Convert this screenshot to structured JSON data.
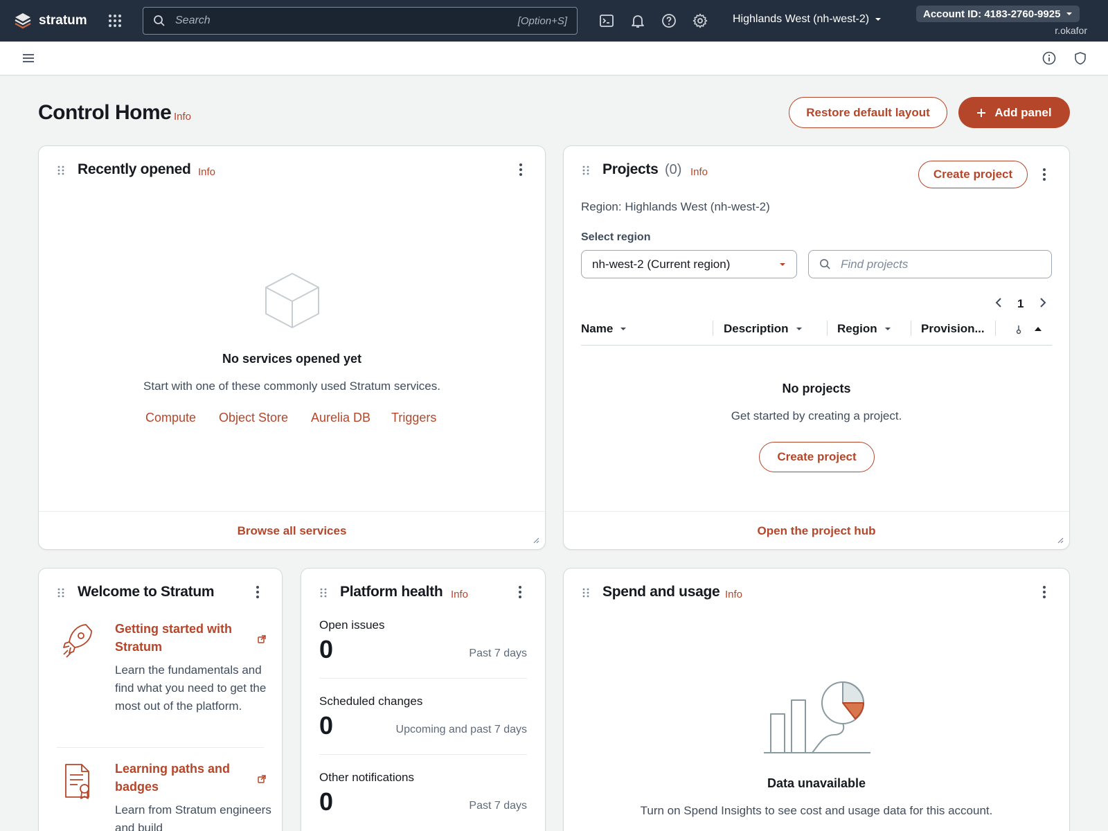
{
  "topnav": {
    "brand": "stratum",
    "search_placeholder": "Search",
    "search_shortcut": "[Option+S]",
    "region": "Highlands West (nh-west-2)",
    "account": "Account ID: 4183-2760-9925",
    "user": "r.okafor"
  },
  "page": {
    "title": "Control Home",
    "info": "Info",
    "restore_label": "Restore default layout",
    "add_panel_label": "Add panel"
  },
  "recently_opened": {
    "title": "Recently opened",
    "info": "Info",
    "empty_title": "No services opened yet",
    "empty_desc": "Start with one of these commonly used Stratum services.",
    "services": [
      "Compute",
      "Object Store",
      "Aurelia DB",
      "Triggers"
    ],
    "footer_link": "Browse all services"
  },
  "projects": {
    "title": "Projects",
    "count": "(0)",
    "info": "Info",
    "create_label": "Create project",
    "region_text": "Region: Highlands West (nh-west-2)",
    "select_label": "Select region",
    "select_value": "nh-west-2 (Current region)",
    "find_placeholder": "Find projects",
    "page_number": "1",
    "columns": [
      "Name",
      "Description",
      "Region",
      "Provision..."
    ],
    "empty_title": "No projects",
    "empty_desc": "Get started by creating a project.",
    "empty_button": "Create project",
    "footer_link": "Open the project hub"
  },
  "welcome": {
    "title": "Welcome to Stratum",
    "items": [
      {
        "title": "Getting started with Stratum",
        "desc": "Learn the fundamentals and find what you need to get the most out of the platform.",
        "icon": "rocket-icon"
      },
      {
        "title": "Learning paths and badges",
        "desc": "Learn from Stratum engineers and build",
        "icon": "certificate-icon"
      }
    ]
  },
  "health": {
    "title": "Platform health",
    "info": "Info",
    "metrics": [
      {
        "label": "Open issues",
        "value": "0",
        "period": "Past 7 days"
      },
      {
        "label": "Scheduled changes",
        "value": "0",
        "period": "Upcoming and past 7 days"
      },
      {
        "label": "Other notifications",
        "value": "0",
        "period": "Past 7 days"
      }
    ]
  },
  "spend": {
    "title": "Spend and usage",
    "info": "Info",
    "empty_title": "Data unavailable",
    "empty_desc": "Turn on Spend Insights to see cost and usage data for this account."
  },
  "colors": {
    "accent": "#b5462a",
    "nav_bg": "#232f3e",
    "page_bg": "#f2f3f3"
  }
}
